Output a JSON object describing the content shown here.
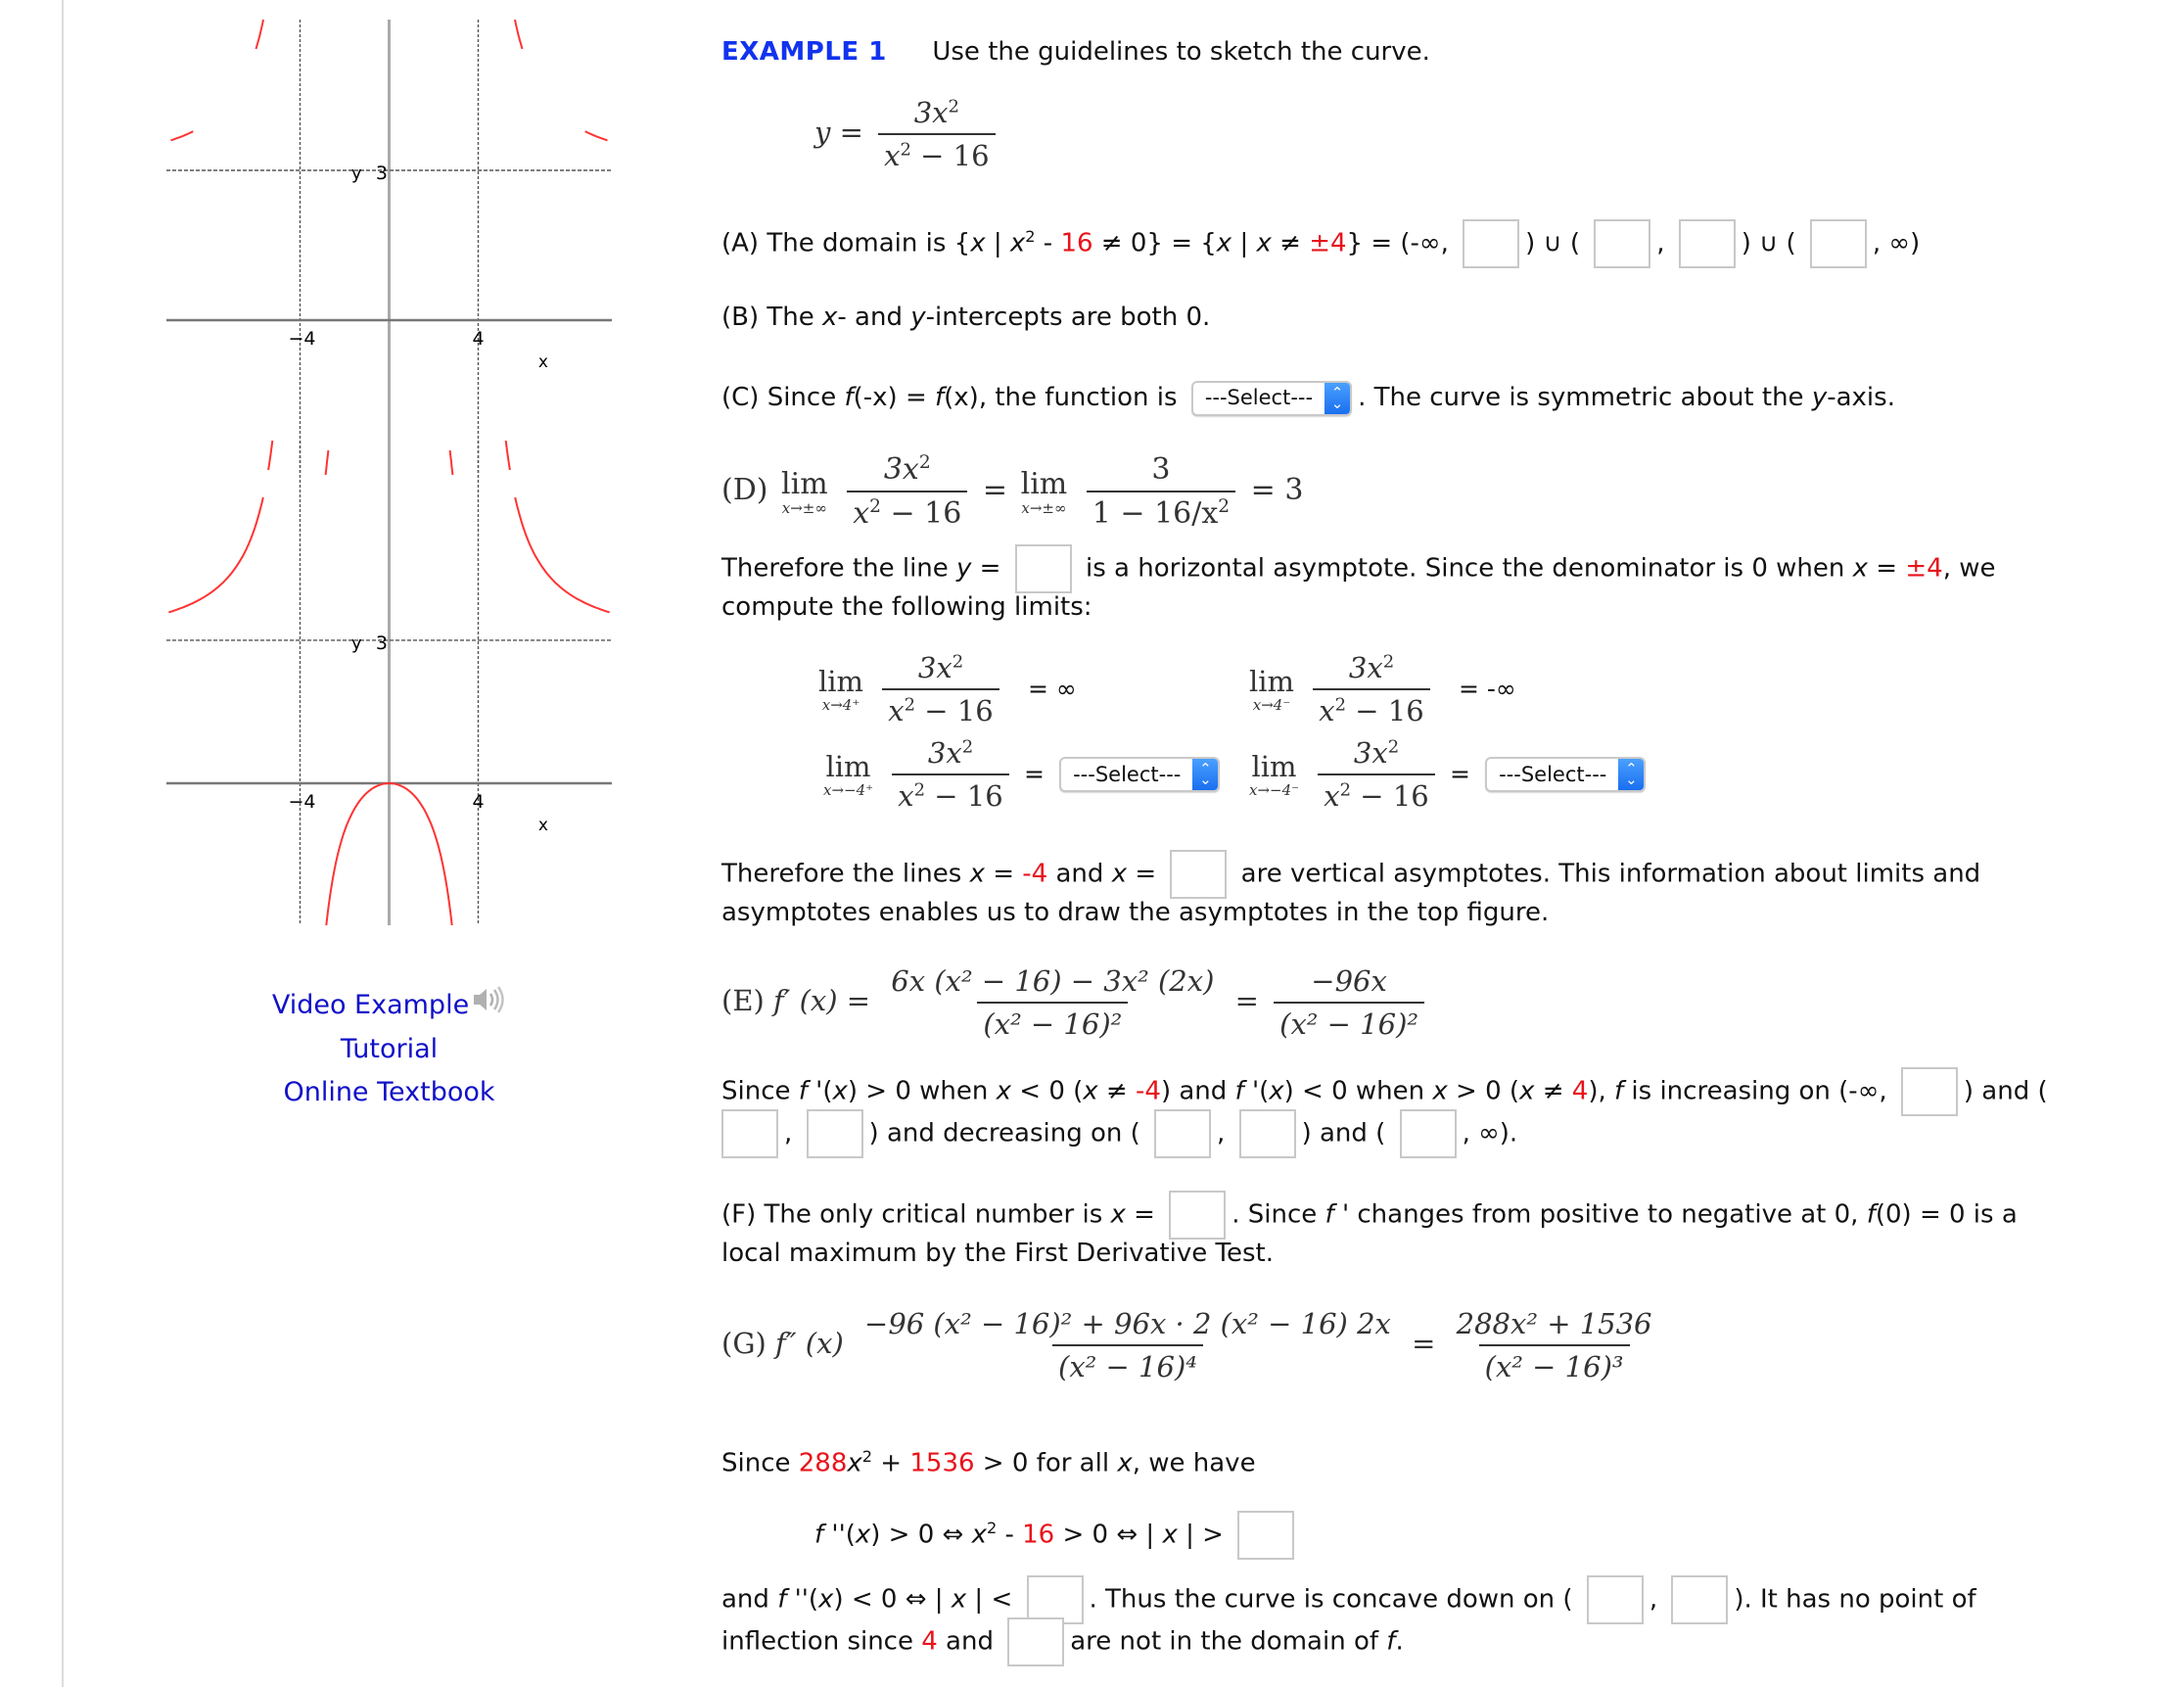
{
  "sidebar": {
    "graphs": [
      {
        "name": "asymptotes-graph",
        "x_tick_neg": "−4",
        "x_tick_pos": "4",
        "x_label": "x",
        "y_label": "y",
        "y_asymptote_label": "3",
        "curve_color": "#ff3333",
        "shows": "asymptote-stubs"
      },
      {
        "name": "full-curve-graph",
        "x_tick_neg": "−4",
        "x_tick_pos": "4",
        "x_label": "x",
        "y_label": "y",
        "y_asymptote_label": "3",
        "curve_color": "#ff3333",
        "shows": "full-curve"
      }
    ],
    "links": {
      "video_example": "Video Example",
      "tutorial": "Tutorial",
      "online_textbook": "Online Textbook"
    }
  },
  "header": {
    "example_label": "EXAMPLE 1",
    "instruction": "Use the guidelines to sketch the curve."
  },
  "function": {
    "lhs": "y =",
    "numerator": "3x",
    "numerator_exp": "2",
    "denominator": "x",
    "denominator_exp": "2",
    "denominator_rest": " − 16"
  },
  "sections": {
    "A": {
      "prefix": "(A) The domain is {",
      "x1": "x",
      "bar1": " | ",
      "x2": "x",
      "exp": "2",
      "minus": " - ",
      "red16": "16",
      "neq0": " ≠ 0} = {",
      "x3": "x",
      "bar2": " | ",
      "x4": "x",
      "neq": " ≠ ",
      "red_pm4": "±4",
      "mid": "} = (-∞,",
      "union1": ") ∪ (",
      "comma": ",",
      "union2": ") ∪ (",
      "end": ", ∞)",
      "inputs": [
        "",
        "",
        "",
        ""
      ]
    },
    "B": {
      "prefix": "(B) The ",
      "x": "x",
      "mid": "- and ",
      "y": "y",
      "suffix": "-intercepts are both 0."
    },
    "C": {
      "prefix": "(C) Since ",
      "f1": "f",
      "p1": "(-x) = ",
      "f2": "f",
      "p2": "(x), the function is",
      "select_value": "---Select---",
      "suffix_1": ". The curve is symmetric about the ",
      "y": "y",
      "suffix_2": "-axis."
    },
    "D": {
      "label": "(D)",
      "lim": "lim",
      "lim_sub": "x→±∞",
      "frac1_num": "3x",
      "frac1_num_exp": "2",
      "frac1_den": "x",
      "frac1_den_exp": "2",
      "frac1_den_rest": " − 16",
      "eq": "=",
      "frac2_num": "3",
      "frac2_den": "1 − 16/x",
      "frac2_den_exp": "2",
      "result": "= 3",
      "text1_prefix": "Therefore the line ",
      "text1_y": "y",
      "text1_eq": " =",
      "text1_input": "",
      "text1_mid": "is a horizontal asymptote. Since the denominator is 0 when ",
      "text1_x": "x",
      "text1_eq2": " = ",
      "text1_red": "±4",
      "text1_end": ", we",
      "text2": "compute the following limits:",
      "limits": [
        {
          "sub": "x→4⁺",
          "num": "3x",
          "num_exp": "2",
          "den": "x",
          "den_exp": "2",
          "den_rest": " − 16",
          "result": "= ∞"
        },
        {
          "sub": "x→4⁻",
          "num": "3x",
          "num_exp": "2",
          "den": "x",
          "den_exp": "2",
          "den_rest": " − 16",
          "result": "= -∞"
        },
        {
          "sub": "x→−4⁺",
          "num": "3x",
          "num_exp": "2",
          "den": "x",
          "den_exp": "2",
          "den_rest": " − 16",
          "eq": "=",
          "select_value": "---Select---"
        },
        {
          "sub": "x→−4⁻",
          "num": "3x",
          "num_exp": "2",
          "den": "x",
          "den_exp": "2",
          "den_rest": " − 16",
          "eq": "=",
          "select_value": "---Select---"
        }
      ],
      "text3_prefix": "Therefore the lines ",
      "text3_x1": "x",
      "text3_eq1": " = ",
      "text3_red": "-4",
      "text3_and": " and ",
      "text3_x2": "x",
      "text3_eq2": " =",
      "text3_input": "",
      "text3_suffix": "are vertical asymptotes. This information about limits and",
      "text4": "asymptotes enables us to draw the asymptotes in the top figure."
    },
    "E": {
      "label": "(E)",
      "fprime": "f′ (x) =",
      "num": "6x (x² − 16) − 3x² (2x)",
      "den": "(x² − 16)²",
      "eq": "=",
      "num2": "−96x",
      "den2": "(x² − 16)²",
      "line1_a": "Since ",
      "line1_f1": "f",
      "line1_b": " '(",
      "line1_x1": "x",
      "line1_c": ") > 0 when ",
      "line1_x2": "x",
      "line1_d": " < 0 (",
      "line1_x3": "x",
      "line1_e": " ≠ ",
      "line1_red1": "-4",
      "line1_f": ") and ",
      "line1_f2": "f",
      "line1_g": " '(",
      "line1_x4": "x",
      "line1_h": ") < 0 when ",
      "line1_x5": "x",
      "line1_i": " > 0 (",
      "line1_x6": "x",
      "line1_j": " ≠ ",
      "line1_red2": "4",
      "line1_k": "), ",
      "line1_f3": "f",
      "line1_l": " is increasing on (-∞,",
      "line1_m": ") and (",
      "line2_comma1": ",",
      "line2_a": ") and decreasing on (",
      "line2_comma2": ",",
      "line2_b": ") and (",
      "line2_end": ", ∞).",
      "inputs": [
        "",
        "",
        "",
        "",
        "",
        ""
      ]
    },
    "F": {
      "prefix": "(F) The only critical number is ",
      "x": "x",
      "eq": " =",
      "input": "",
      "mid1": ". Since ",
      "f1": "f",
      "mid2": " ' changes from positive to negative at 0, ",
      "f2": "f",
      "mid3": "(0) = 0 is a",
      "line2": "local maximum by the First Derivative Test."
    },
    "G": {
      "label": "(G)",
      "fdouble": "f″ (x)",
      "num": "−96 (x² − 16)² + 96x · 2 (x² − 16) 2x",
      "den": "(x² − 16)⁴",
      "eq": "=",
      "num2": "288x² + 1536",
      "den2": "(x² − 16)³",
      "since_a": "Since ",
      "since_red1": "288",
      "since_x": "x",
      "since_exp": "2",
      "since_plus": " + ",
      "since_red2": "1536",
      "since_b": " > 0 for all ",
      "since_x2": "x",
      "since_c": ", we have",
      "ineq_f": "f",
      "ineq_a": " ''(",
      "ineq_x": "x",
      "ineq_b": ") > 0 ⇔ ",
      "ineq_x2": "x",
      "ineq_exp": "2",
      "ineq_c": " - ",
      "ineq_red": "16",
      "ineq_d": " > 0 ⇔ | ",
      "ineq_x3": "x",
      "ineq_e": " | >",
      "ineq_input": "",
      "and_a": "and ",
      "and_f": "f",
      "and_b": " ''(",
      "and_x": "x",
      "and_c": ") < 0 ⇔ | ",
      "and_x2": "x",
      "and_d": " | <",
      "and_e": ". Thus the curve is concave down on (",
      "and_comma": ",",
      "and_g": "). It has no point of",
      "infl_a": "inflection since ",
      "infl_red": "4",
      "infl_b": " and",
      "infl_c": "are not in the domain of ",
      "infl_f": "f",
      "infl_d": ".",
      "inputs": [
        "",
        "",
        "",
        "",
        ""
      ]
    }
  }
}
